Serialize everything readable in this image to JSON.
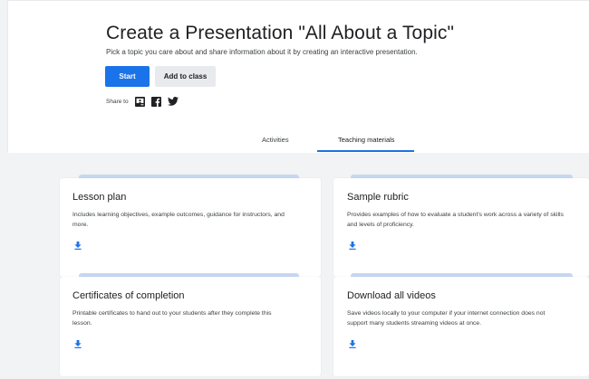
{
  "header": {
    "title": "Create a Presentation \"All About a Topic\"",
    "subtitle": "Pick a topic you care about and share information about it by creating an interactive presentation.",
    "start_label": "Start",
    "add_to_class_label": "Add to class",
    "share_label": "Share to"
  },
  "share_icons": [
    "google-classroom-icon",
    "facebook-icon",
    "twitter-icon"
  ],
  "tabs": [
    {
      "label": "Activities",
      "selected": false
    },
    {
      "label": "Teaching materials",
      "selected": true
    }
  ],
  "cards": [
    {
      "title": "Lesson plan",
      "desc_lines": [
        "Includes learning objectives, example outcomes, guidance for instructors, and",
        "more."
      ],
      "icon": "download-icon"
    },
    {
      "title": "Sample rubric",
      "desc_lines": [
        "Provides examples of how to evaluate a student's work across a variety of skills",
        "and levels of proficiency."
      ],
      "icon": "download-icon"
    },
    {
      "title": "Certificates of completion",
      "desc_lines": [
        "Printable certificates to hand out to your students after they complete this",
        "lesson."
      ],
      "icon": "download-icon"
    },
    {
      "title": "Download all videos",
      "desc_lines": [
        "Save videos locally to your computer if your internet connection does not",
        "support many students streaming videos at once."
      ],
      "icon": "download-icon"
    }
  ],
  "colors": {
    "accent": "#1a73e8",
    "card_tab": "#c6d7f2",
    "background": "#f1f3f4"
  }
}
